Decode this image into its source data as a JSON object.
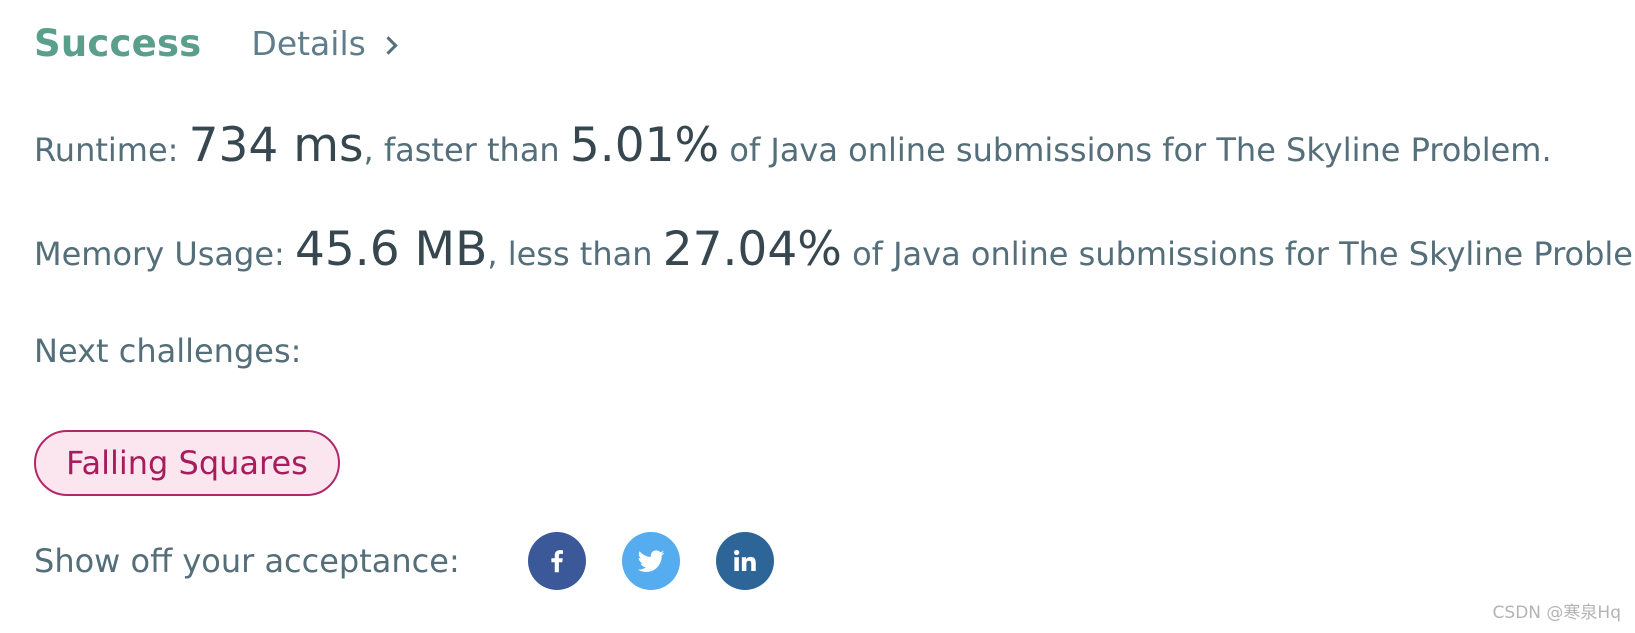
{
  "header": {
    "status": "Success",
    "details_label": "Details"
  },
  "runtime": {
    "label": "Runtime: ",
    "value": "734 ms",
    "comparison": ", faster than ",
    "percent": "5.01%",
    "suffix": " of Java online submissions for The Skyline Problem."
  },
  "memory": {
    "label": "Memory Usage: ",
    "value": "45.6 MB",
    "comparison": ", less than ",
    "percent": "27.04%",
    "suffix": " of Java online submissions for The Skyline Problem."
  },
  "next": {
    "label": "Next challenges:",
    "challenges": [
      "Falling Squares"
    ]
  },
  "share": {
    "label": "Show off your acceptance:",
    "buttons": [
      {
        "icon": "facebook-icon",
        "color": "#3b5998"
      },
      {
        "icon": "twitter-icon",
        "color": "#55acee"
      },
      {
        "icon": "linkedin-icon",
        "color": "#2e6599"
      }
    ]
  },
  "watermark": "CSDN @寒泉Hq",
  "colors": {
    "success": "#5a9e8c",
    "challenge_border": "#b0286b",
    "challenge_bg": "#fbe6ef"
  }
}
